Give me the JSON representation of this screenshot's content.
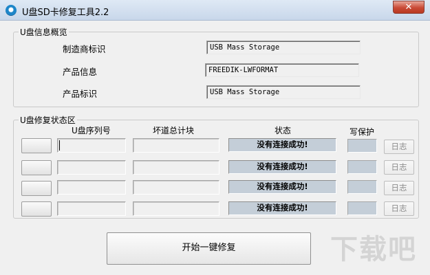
{
  "window": {
    "title": "U盘SD卡修复工具2.2",
    "close_label": "✕"
  },
  "info_group": {
    "title": "U盘信息概览",
    "rows": [
      {
        "label": "制造商标识",
        "value": "USB Mass Storage"
      },
      {
        "label": "产品信息",
        "value": "FREEDIK-LWFORMAT"
      },
      {
        "label": "产品标识",
        "value": "USB Mass Storage"
      }
    ]
  },
  "repair_group": {
    "title": "U盘修复状态区",
    "headers": {
      "serial": "U盘序列号",
      "bad_blocks": "坏道总计块",
      "status": "状态",
      "protect": "写保护"
    },
    "rows": [
      {
        "serial": "",
        "bad_blocks": "",
        "status": "没有连接成功!",
        "log": "日志"
      },
      {
        "serial": "",
        "bad_blocks": "",
        "status": "没有连接成功!",
        "log": "日志"
      },
      {
        "serial": "",
        "bad_blocks": "",
        "status": "没有连接成功!",
        "log": "日志"
      },
      {
        "serial": "",
        "bad_blocks": "",
        "status": "没有连接成功!",
        "log": "日志"
      }
    ]
  },
  "start_button": "开始一键修复",
  "watermark": {
    "text": "下载吧",
    "color": "#a0a0a0"
  },
  "colors": {
    "status_bg": "#c4ced8",
    "close_red": "#c94a36"
  }
}
